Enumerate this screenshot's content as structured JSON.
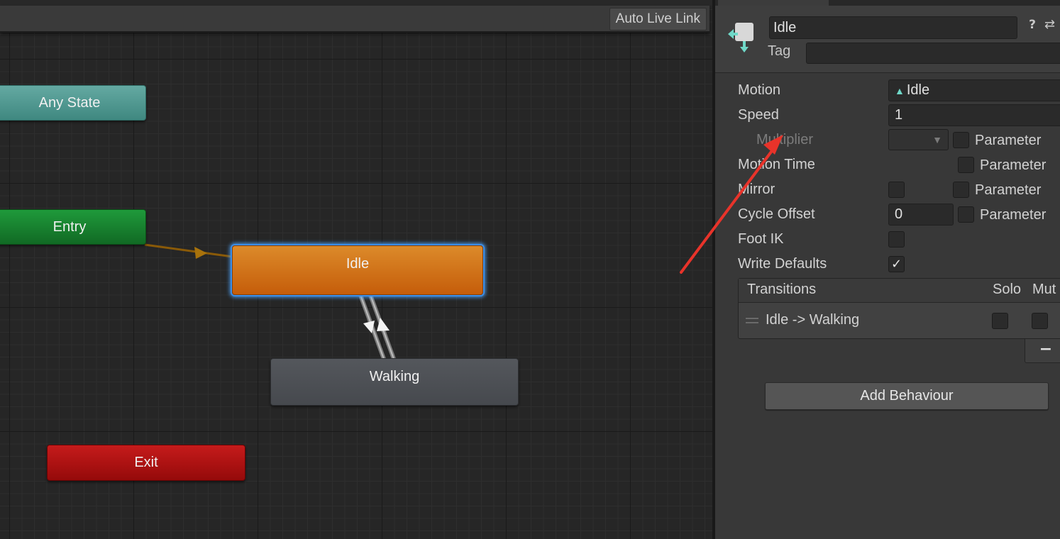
{
  "graph": {
    "toolbar": {
      "live_link_label": "Auto Live Link"
    },
    "nodes": {
      "any_state": "Any State",
      "entry": "Entry",
      "idle": "Idle",
      "walking": "Walking",
      "exit": "Exit"
    }
  },
  "inspector": {
    "state_name": "Idle",
    "tag_label": "Tag",
    "tag_value": "",
    "properties": {
      "motion_label": "Motion",
      "motion_value": "Idle",
      "speed_label": "Speed",
      "speed_value": "1",
      "multiplier_label": "Multiplier",
      "motion_time_label": "Motion Time",
      "mirror_label": "Mirror",
      "cycle_offset_label": "Cycle Offset",
      "cycle_offset_value": "0",
      "foot_ik_label": "Foot IK",
      "write_defaults_label": "Write Defaults",
      "parameter_label": "Parameter"
    },
    "transitions": {
      "header": "Transitions",
      "solo_label": "Solo",
      "mute_label": "Mut",
      "items": [
        {
          "label": "Idle -> Walking"
        }
      ]
    },
    "minus_label": "−",
    "add_behaviour_label": "Add Behaviour"
  },
  "colors": {
    "annotation_arrow": "#e8332a",
    "idle_node": "#d2771c",
    "entry_node": "#168232",
    "any_state_node": "#4f988f",
    "exit_node": "#ad1212",
    "selection_glow": "#3b8ee8"
  }
}
